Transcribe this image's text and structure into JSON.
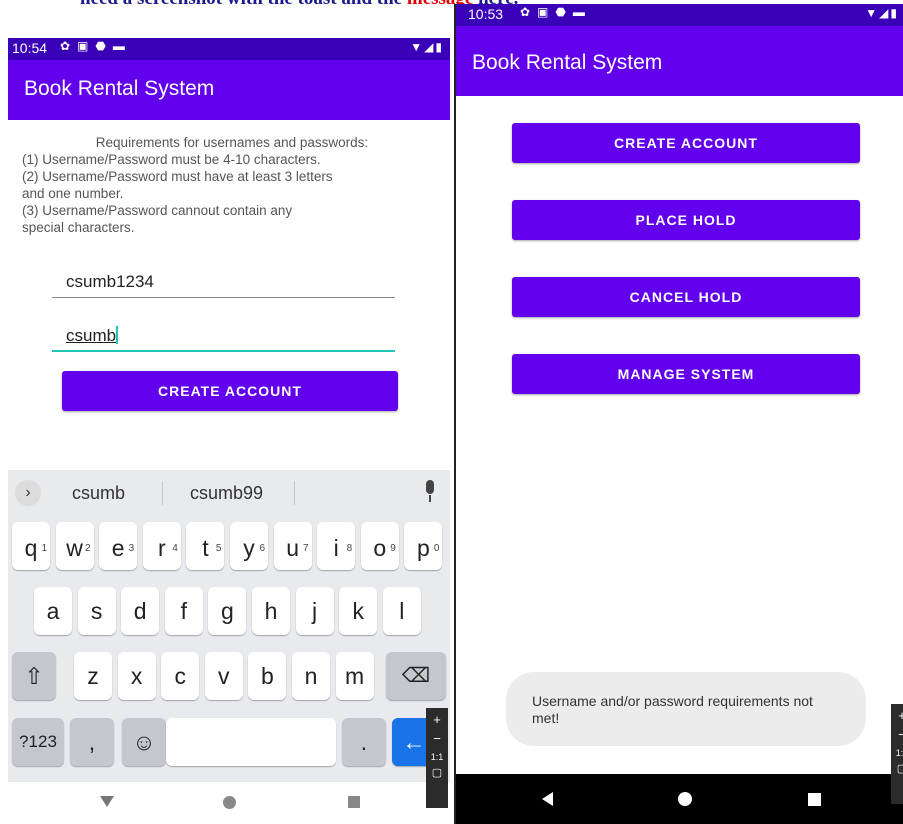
{
  "top_banner": {
    "text": "need a screenshot with the toast and the ",
    "red": "message",
    "suffix": "here."
  },
  "left_phone": {
    "status_time": "10:54",
    "app_title": "Book Rental System",
    "requirements": {
      "heading": "Requirements for usernames and passwords:",
      "lines": [
        "(1) Username/Password must be 4-10 characters.",
        "(2) Username/Password must have at least 3 letters",
        "and one number.",
        "(3) Username/Password cannout contain any",
        "special characters."
      ]
    },
    "username_value": "csumb1234",
    "password_value": "csumb",
    "create_account_label": "CREATE ACCOUNT",
    "keyboard": {
      "suggestions": [
        "csumb",
        "csumb99"
      ],
      "row1": [
        [
          "q",
          "1"
        ],
        [
          "w",
          "2"
        ],
        [
          "e",
          "3"
        ],
        [
          "r",
          "4"
        ],
        [
          "t",
          "5"
        ],
        [
          "y",
          "6"
        ],
        [
          "u",
          "7"
        ],
        [
          "i",
          "8"
        ],
        [
          "o",
          "9"
        ],
        [
          "p",
          "0"
        ]
      ],
      "row2": [
        "a",
        "s",
        "d",
        "f",
        "g",
        "h",
        "j",
        "k",
        "l"
      ],
      "row3": [
        "z",
        "x",
        "c",
        "v",
        "b",
        "n",
        "m"
      ],
      "symbols_label": "?123",
      "comma_label": ",",
      "period_label": "."
    }
  },
  "right_phone": {
    "status_time": "10:53",
    "app_title": "Book Rental System",
    "buttons": [
      "CREATE ACCOUNT",
      "PLACE HOLD",
      "CANCEL HOLD",
      "MANAGE SYSTEM"
    ],
    "toast": "Username and/or password requirements not met!"
  },
  "zoom_labels": {
    "plus": "+",
    "minus": "−",
    "ratio": "1:1"
  },
  "colors": {
    "primary": "#6200ee",
    "status_bar": "#3a00b8",
    "accent": "#20c5b3",
    "enter_key": "#1a73e8"
  }
}
